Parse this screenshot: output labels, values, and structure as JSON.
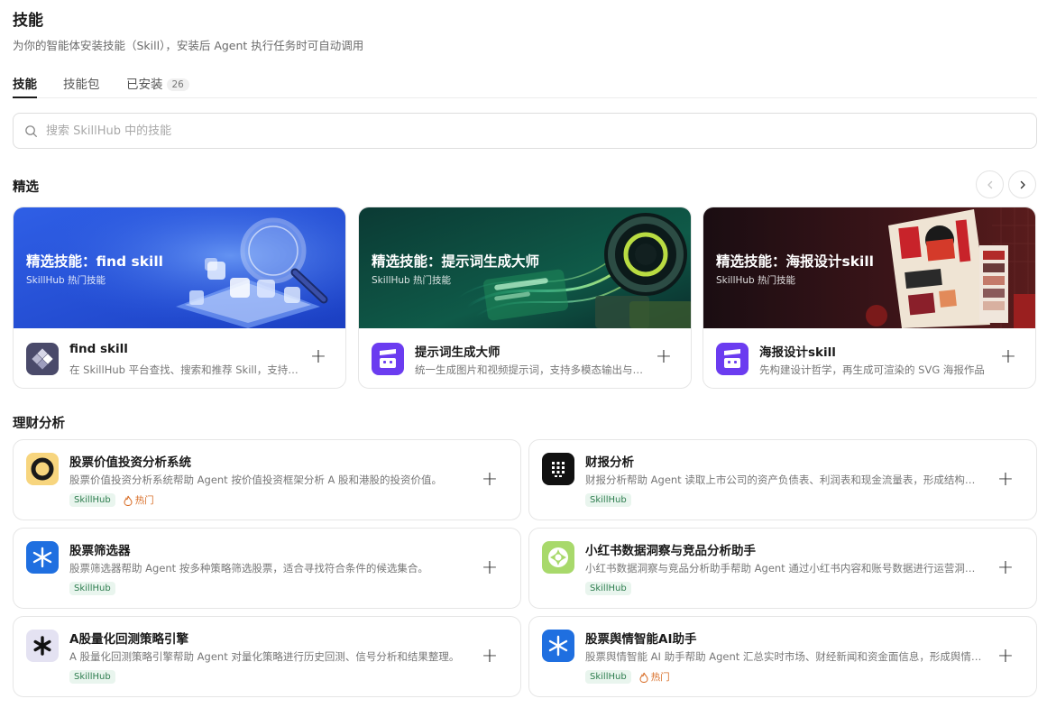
{
  "header": {
    "title": "技能",
    "subtitle": "为你的智能体安装技能（Skill），安装后 Agent 执行任务时可自动调用"
  },
  "tabs": [
    {
      "label": "技能",
      "active": true
    },
    {
      "label": "技能包",
      "active": false
    },
    {
      "label": "已安装",
      "count": "26",
      "active": false
    }
  ],
  "search": {
    "placeholder": "搜索 SkillHub 中的技能",
    "value": ""
  },
  "featured": {
    "title": "精选",
    "prev_icon": "chevron-left-icon",
    "next_icon": "chevron-right-icon",
    "cards": [
      {
        "banner_title": "精选技能：find skill",
        "banner_sub": "SkillHub 热门技能",
        "name": "find skill",
        "desc": "在 SkillHub 平台查找、搜索和推荐 Skill，支持按关键词和分类检索",
        "logo_color": "#4a4a6a"
      },
      {
        "banner_title": "精选技能：提示词生成大师",
        "banner_sub": "SkillHub 热门技能",
        "name": "提示词生成大师",
        "desc": "统一生成图片和视频提示词，支持多模态输出与风格控制",
        "logo_color": "#6b3cf0"
      },
      {
        "banner_title": "精选技能：海报设计skill",
        "banner_sub": "SkillHub 热门技能",
        "name": "海报设计skill",
        "desc": "先构建设计哲学，再生成可渲染的 SVG 海报作品",
        "logo_color": "#6b3cf0"
      }
    ]
  },
  "finance": {
    "title": "理财分析",
    "items": [
      {
        "name": "股票价值投资分析系统",
        "desc": "股票价值投资分析系统帮助 Agent 按价值投资框架分析 A 股和港股的投资价值。",
        "source": "SkillHub",
        "hot": "热门",
        "logo": "ring",
        "logo_bg": "#f7d57e"
      },
      {
        "name": "财报分析",
        "desc": "财报分析帮助 Agent 读取上市公司的资产负债表、利润表和现金流量表，形成结构化分析结论。",
        "source": "SkillHub",
        "hot": "",
        "logo": "grid",
        "logo_bg": "#111111"
      },
      {
        "name": "股票筛选器",
        "desc": "股票筛选器帮助 Agent 按多种策略筛选股票，适合寻找符合条件的候选集合。",
        "source": "SkillHub",
        "hot": "",
        "logo": "spark",
        "logo_bg": "#1f6fe0"
      },
      {
        "name": "小红书数据洞察与竞品分析助手",
        "desc": "小红书数据洞察与竞品分析助手帮助 Agent 通过小红书内容和账号数据进行运营洞察。",
        "source": "SkillHub",
        "hot": "",
        "logo": "flower",
        "logo_bg": "#a8d96b"
      },
      {
        "name": "A股量化回测策略引擎",
        "desc": "A 股量化回测策略引擎帮助 Agent 对量化策略进行历史回测、信号分析和结果整理。",
        "source": "SkillHub",
        "hot": "",
        "logo": "asterisk",
        "logo_bg": "#e4e2f2"
      },
      {
        "name": "股票舆情智能AI助手",
        "desc": "股票舆情智能 AI 助手帮助 Agent 汇总实时市场、财经新闻和资金面信息，形成舆情判断。",
        "source": "SkillHub",
        "hot": "热门",
        "logo": "spark",
        "logo_bg": "#1f6fe0"
      }
    ]
  }
}
